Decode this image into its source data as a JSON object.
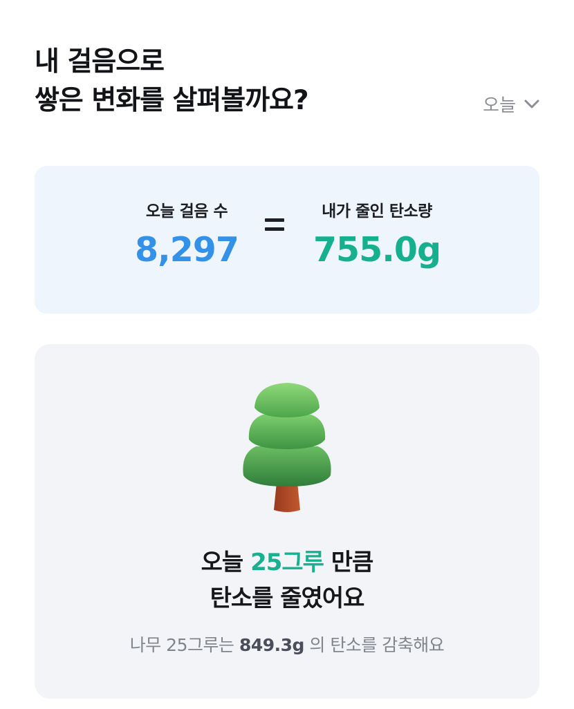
{
  "header": {
    "title_line1": "내 걸음으로",
    "title_line2": "쌓은 변화를 살펴볼까요?",
    "period_label": "오늘",
    "period_icon": "chevron-down-icon"
  },
  "stats": {
    "steps_label": "오늘 걸음 수",
    "steps_value": "8,297",
    "equals_symbol": "=",
    "carbon_label": "내가 줄인 탄소량",
    "carbon_value": "755.0g"
  },
  "tree_card": {
    "illustration": "tree-icon",
    "line1_prefix": "오늘 ",
    "line1_highlight": "25그루",
    "line1_suffix": " 만큼",
    "line2": "탄소를 줄였어요",
    "note_prefix": "나무 25그루는 ",
    "note_value": "849.3g",
    "note_suffix": " 의 탄소를 감축해요"
  },
  "colors": {
    "steps_blue": "#3392e8",
    "carbon_green": "#17b08f",
    "stat_card_bg": "#eef5fd",
    "tree_card_bg": "#f3f4f8"
  }
}
